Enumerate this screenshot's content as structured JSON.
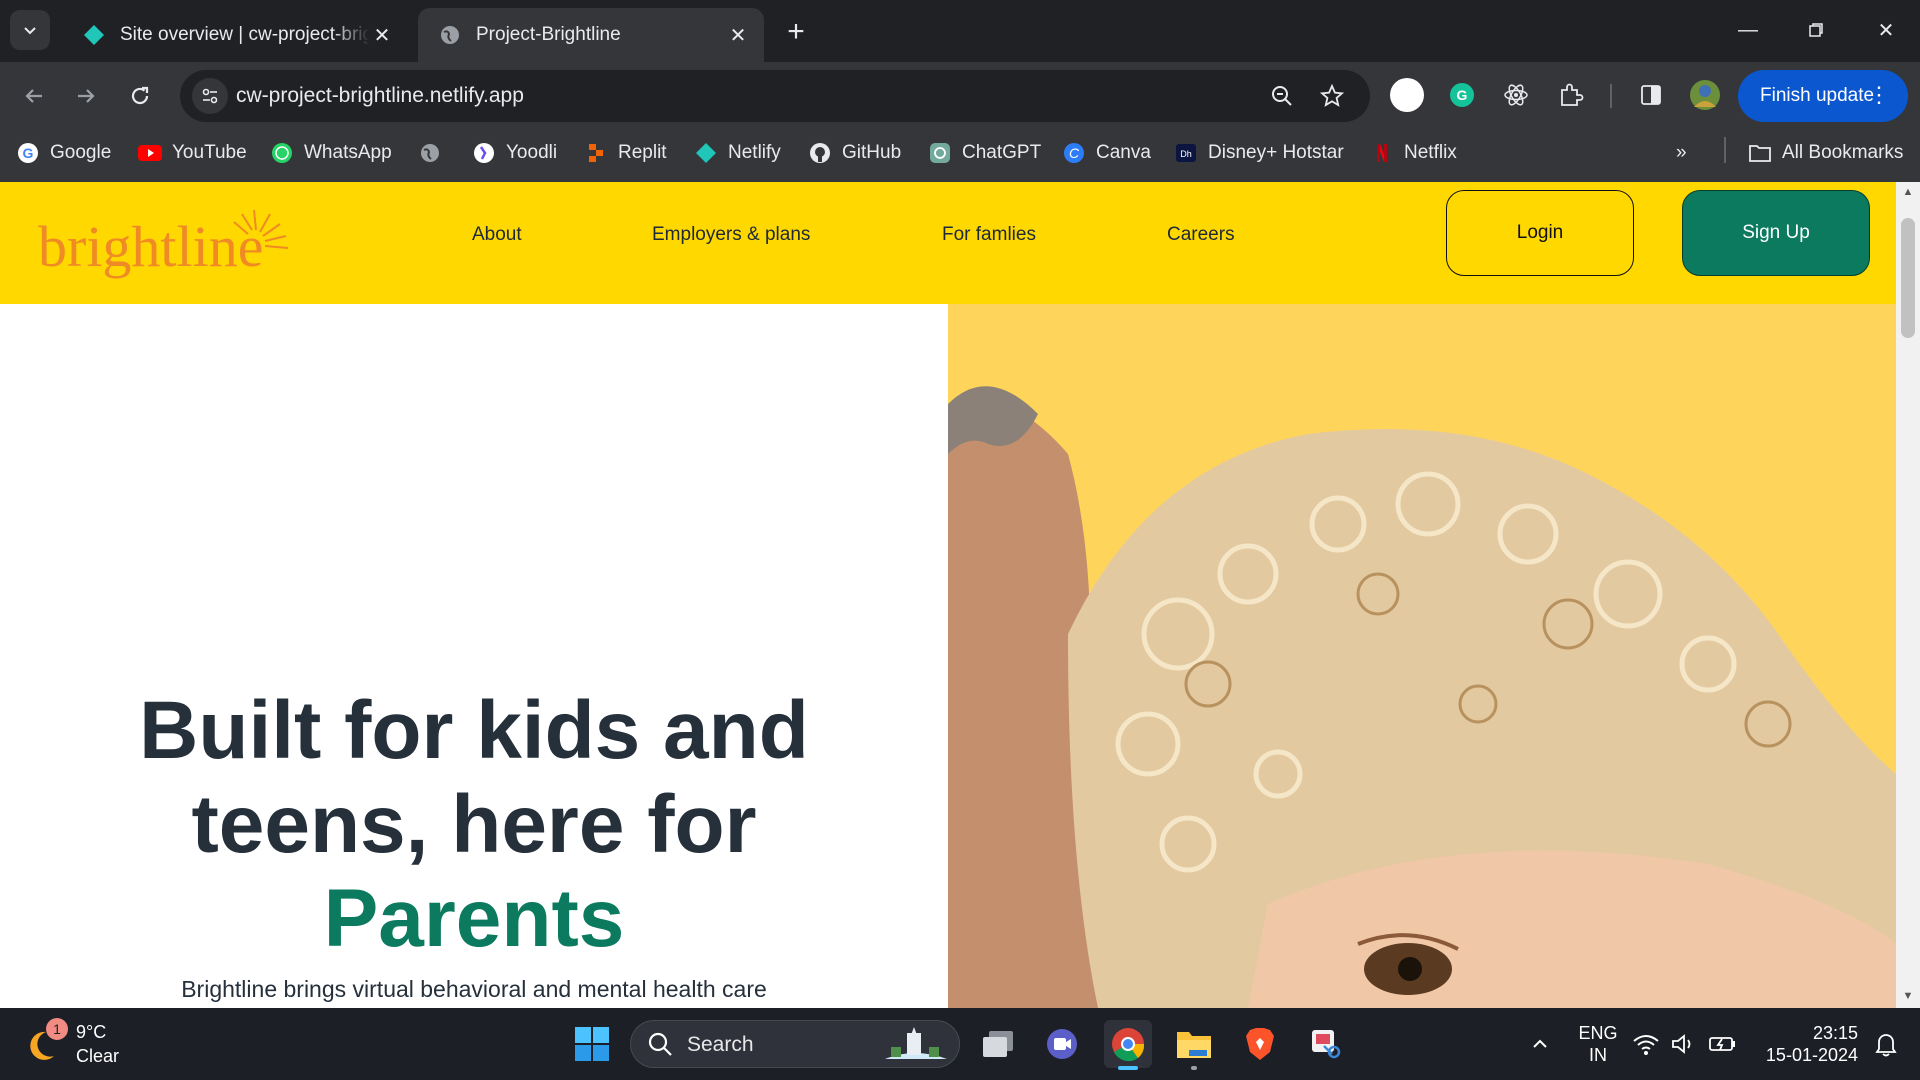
{
  "browser": {
    "tabs": [
      {
        "title": "Site overview | cw-project-brightline",
        "active": false
      },
      {
        "title": "Project-Brightline",
        "active": true
      }
    ],
    "url": "cw-project-brightline.netlify.app",
    "finish_update_label": "Finish update",
    "bookmarks": [
      {
        "label": "Google",
        "icon": "google-icon"
      },
      {
        "label": "YouTube",
        "icon": "youtube-icon"
      },
      {
        "label": "WhatsApp",
        "icon": "whatsapp-icon"
      },
      {
        "label": "",
        "icon": "globe-icon"
      },
      {
        "label": "Yoodli",
        "icon": "yoodli-icon"
      },
      {
        "label": "Replit",
        "icon": "replit-icon"
      },
      {
        "label": "Netlify",
        "icon": "netlify-icon"
      },
      {
        "label": "GitHub",
        "icon": "github-icon"
      },
      {
        "label": "ChatGPT",
        "icon": "chatgpt-icon"
      },
      {
        "label": "Canva",
        "icon": "canva-icon"
      },
      {
        "label": "Disney+ Hotstar",
        "icon": "hotstar-icon"
      },
      {
        "label": "Netflix",
        "icon": "netflix-icon"
      }
    ],
    "all_bookmarks_label": "All Bookmarks"
  },
  "site": {
    "logo_text": "brightline",
    "nav": [
      "About",
      "Employers & plans",
      "For famlies",
      "Careers"
    ],
    "login_label": "Login",
    "signup_label": "Sign Up",
    "headline_line1": "Built for kids and",
    "headline_line2": "teens, here for",
    "headline_accent": "Parents",
    "subtext": "Brightline brings virtual behavioral and mental health care",
    "colors": {
      "brand_yellow": "#ffd800",
      "brand_green": "#0b7a5e",
      "hero_image_bg": "#fed55a"
    }
  },
  "taskbar": {
    "weather_temp": "9°C",
    "weather_desc": "Clear",
    "weather_badge": "1",
    "search_label": "Search",
    "lang_line1": "ENG",
    "lang_line2": "IN",
    "time": "23:15",
    "date": "15-01-2024"
  }
}
